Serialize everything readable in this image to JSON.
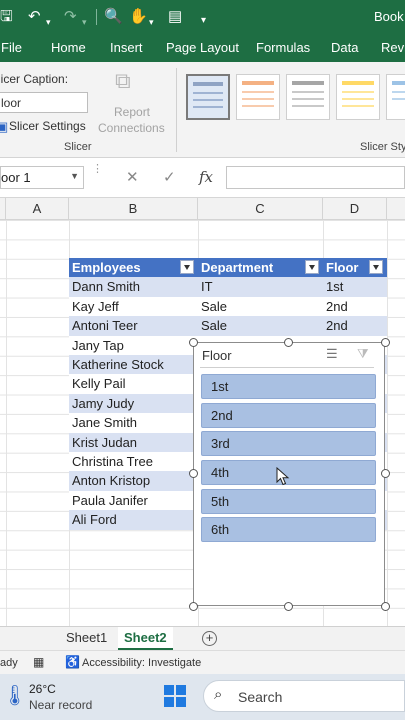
{
  "titlebar": {
    "book": "Book",
    "icons": [
      "save-icon",
      "undo-icon",
      "redo-icon",
      "print-preview-icon",
      "touch-mode-icon",
      "form-icon",
      "customize-qat-icon"
    ]
  },
  "ribbon_tabs": [
    "File",
    "Home",
    "Insert",
    "Page Layout",
    "Formulas",
    "Data",
    "Revi"
  ],
  "ribbon": {
    "caption_label": "licer Caption:",
    "caption_value": "loor",
    "settings_label": "Slicer Settings",
    "report_connections_line1": "Report",
    "report_connections_line2": "Connections",
    "group_slicer": "Slicer",
    "group_styles": "Slicer Styl"
  },
  "formula_bar": {
    "name_box": "oor 1",
    "cancel": "✕",
    "enter": "✓",
    "fx": "fx"
  },
  "columns": [
    "A",
    "B",
    "C",
    "D"
  ],
  "table": {
    "headers": [
      "Employees",
      "Department",
      "Floor"
    ],
    "rows": [
      [
        "Dann Smith",
        "IT",
        "1st"
      ],
      [
        "Kay Jeff",
        "Sale",
        "2nd"
      ],
      [
        "Antoni Teer",
        "Sale",
        "2nd"
      ],
      [
        "Jany Tap",
        "",
        ""
      ],
      [
        "Katherine Stock",
        "",
        ""
      ],
      [
        "Kelly Pail",
        "",
        ""
      ],
      [
        "Jamy Judy",
        "",
        ""
      ],
      [
        "Jane Smith",
        "",
        ""
      ],
      [
        "Krist Judan",
        "",
        ""
      ],
      [
        "Christina Tree",
        "",
        ""
      ],
      [
        "Anton Kristop",
        "",
        ""
      ],
      [
        "Paula Janifer",
        "",
        ""
      ],
      [
        "Ali Ford",
        "",
        ""
      ]
    ]
  },
  "slicer": {
    "title": "Floor",
    "items": [
      "1st",
      "2nd",
      "3rd",
      "4th",
      "5th",
      "6th"
    ],
    "colors": {
      "item_fill": "#a9c0e2",
      "item_border": "#8fa9d3"
    }
  },
  "sheets": {
    "tabs": [
      "Sheet1",
      "Sheet2"
    ],
    "active": "Sheet2"
  },
  "status": {
    "ready": "ady",
    "accessibility": "Accessibility: Investigate"
  },
  "taskbar": {
    "temp": "26°C",
    "weather_note": "Near record",
    "search": "Search"
  },
  "colors": {
    "excel_green": "#1e6e43",
    "table_header": "#4472c4",
    "table_band": "#d9e1f2"
  }
}
